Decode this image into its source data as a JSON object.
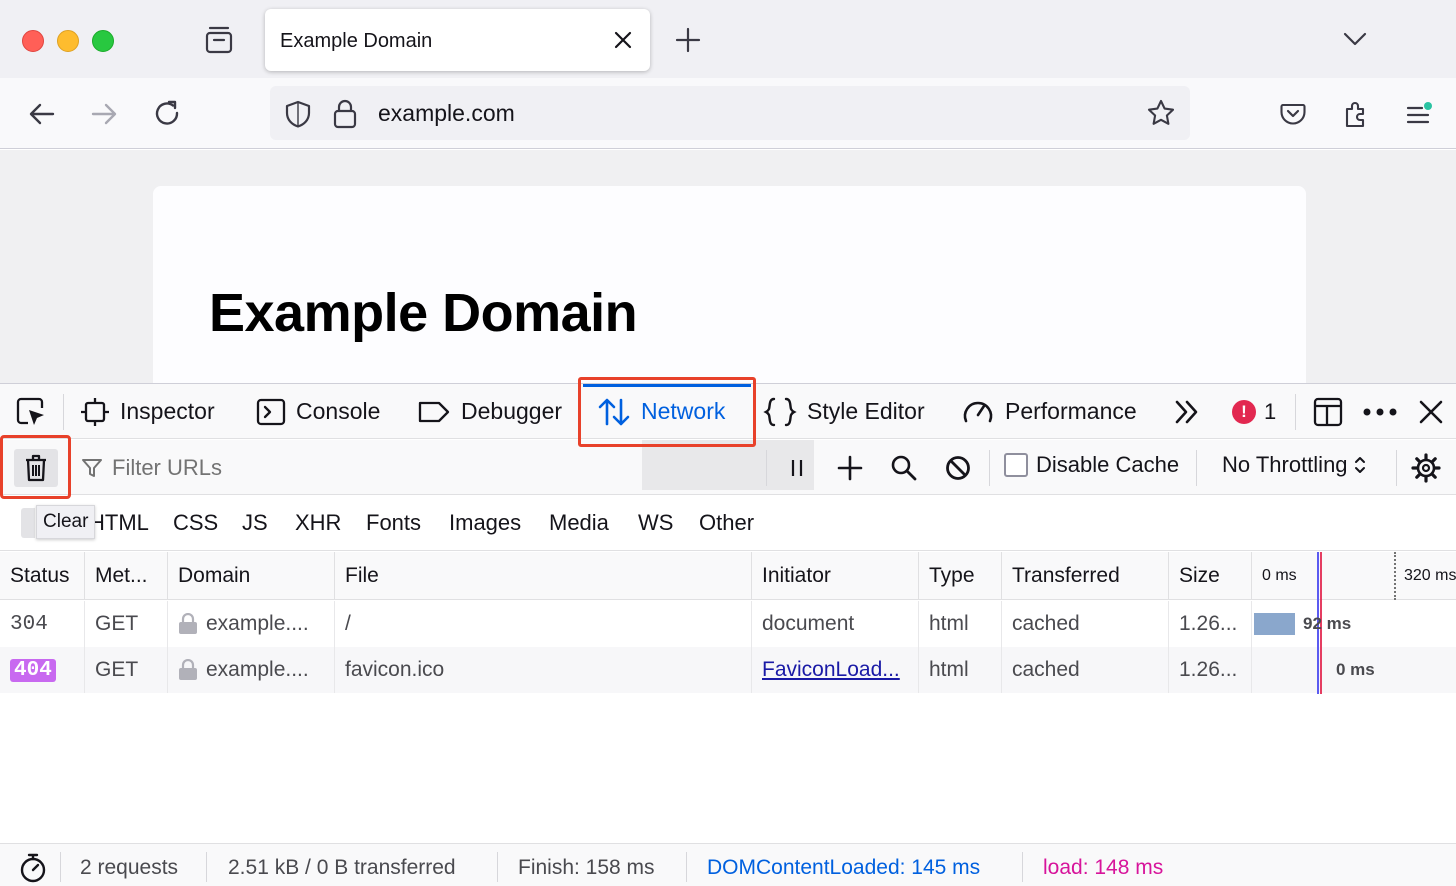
{
  "browser": {
    "tab_title": "Example Domain",
    "url": "example.com"
  },
  "page": {
    "heading": "Example Domain"
  },
  "devtools": {
    "tabs": [
      {
        "label": "Inspector"
      },
      {
        "label": "Console"
      },
      {
        "label": "Debugger"
      },
      {
        "label": "Network"
      },
      {
        "label": "Style Editor"
      },
      {
        "label": "Performance"
      }
    ],
    "error_count": "1",
    "error_badge": "!"
  },
  "network": {
    "filter_placeholder": "Filter URLs",
    "disable_cache_label": "Disable Cache",
    "throttling": "No Throttling",
    "clear_tooltip": "Clear",
    "type_filters": [
      "HTML",
      "CSS",
      "JS",
      "XHR",
      "Fonts",
      "Images",
      "Media",
      "WS",
      "Other"
    ],
    "columns": [
      "Status",
      "Met...",
      "Domain",
      "File",
      "Initiator",
      "Type",
      "Transferred",
      "Size",
      "0 ms",
      "320 ms"
    ],
    "requests": [
      {
        "status": "304",
        "method": "GET",
        "domain": "example....",
        "file": "/",
        "initiator": "document",
        "type": "html",
        "transferred": "cached",
        "size": "1.26...",
        "timing": "92 ms"
      },
      {
        "status": "404",
        "method": "GET",
        "domain": "example....",
        "file": "favicon.ico",
        "initiator": "FaviconLoad...",
        "type": "html",
        "transferred": "cached",
        "size": "1.26...",
        "timing": "0 ms"
      }
    ],
    "summary": {
      "requests": "2 requests",
      "transferred": "2.51 kB / 0 B transferred",
      "finish": "Finish: 158 ms",
      "dom_content_loaded": "DOMContentLoaded: 145 ms",
      "load": "load: 148 ms"
    }
  },
  "colors": {
    "accent": "#0060df",
    "highlight": "#e8412a",
    "dom_content_loaded": "#0060df",
    "load": "#d7149b",
    "status_404_badge": "#c869f0"
  }
}
